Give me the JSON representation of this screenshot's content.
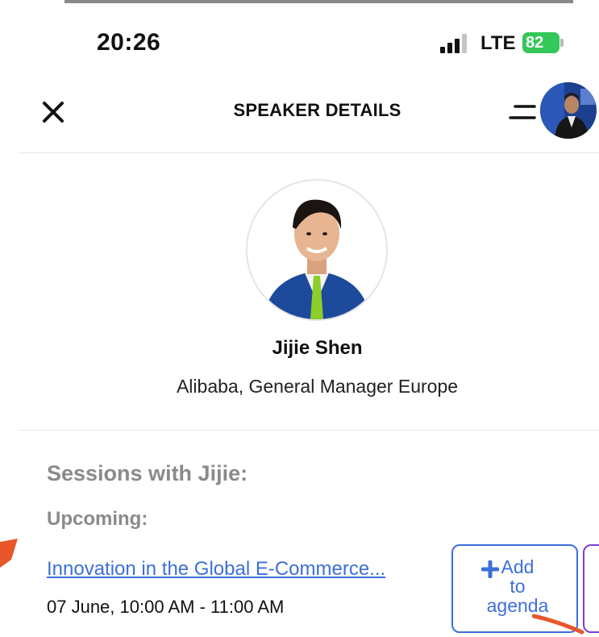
{
  "status_bar": {
    "time": "20:26",
    "network": "LTE",
    "battery": "82"
  },
  "header": {
    "title": "SPEAKER DETAILS"
  },
  "speaker": {
    "name": "Jijie Shen",
    "role": "Alibaba, General Manager Europe"
  },
  "sessions": {
    "heading": "Sessions with Jijie:",
    "upcoming_label": "Upcoming:",
    "items": [
      {
        "title": "Innovation in the Global E-Commerce...",
        "time": "07 June, 10:00 AM - 11:00 AM",
        "add_label": "Add\nto\nagenda"
      }
    ]
  },
  "colors": {
    "accent": "#3d6fd9",
    "battery": "#34c759",
    "annotation": "#e8562a",
    "secondary_button_border": "#7b3fd1"
  },
  "icons": [
    "close-icon",
    "menu-icon",
    "plus-icon",
    "signal-icon",
    "battery-icon"
  ]
}
